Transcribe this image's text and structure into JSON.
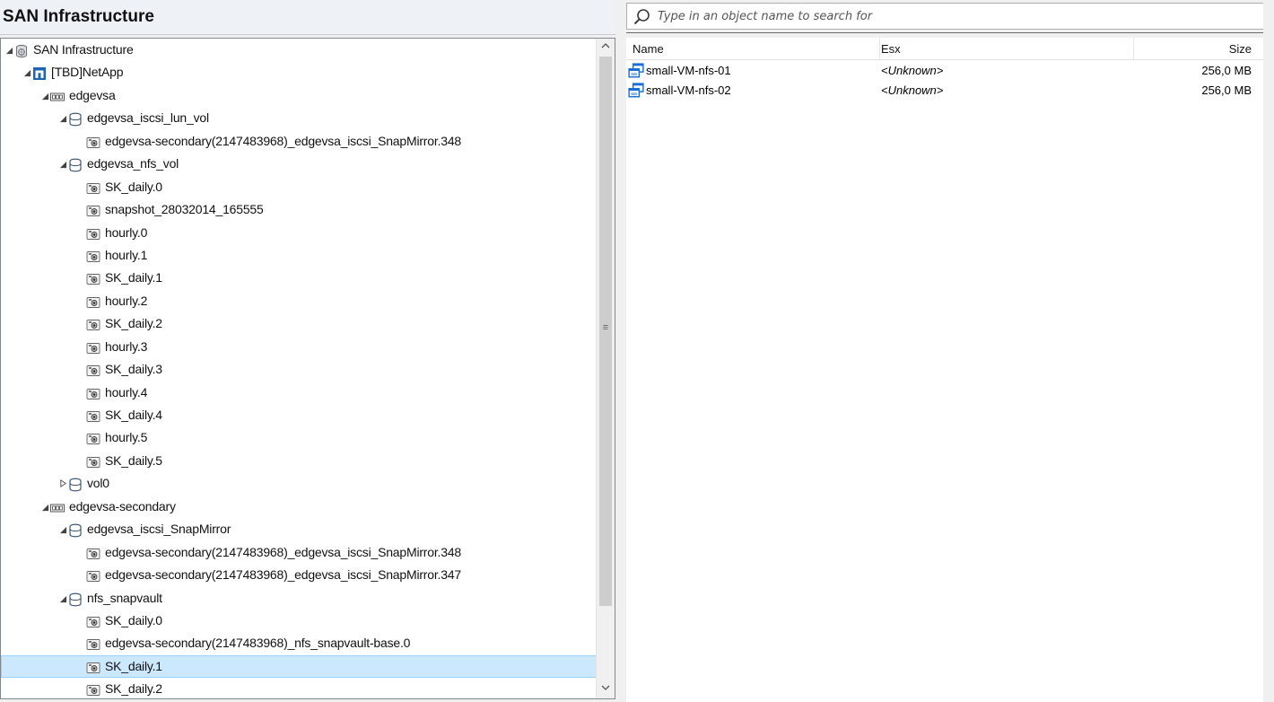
{
  "left_panel": {
    "title": "SAN Infrastructure",
    "tree": [
      {
        "label": "SAN Infrastructure",
        "level": 0,
        "expander": "expanded",
        "icon": "database-globe-icon"
      },
      {
        "label": "[TBD]NetApp",
        "level": 1,
        "expander": "expanded",
        "icon": "netapp-icon"
      },
      {
        "label": "edgevsa",
        "level": 2,
        "expander": "expanded",
        "icon": "storage-server-icon"
      },
      {
        "label": "edgevsa_iscsi_lun_vol",
        "level": 3,
        "expander": "expanded",
        "icon": "volume-icon"
      },
      {
        "label": "edgevsa-secondary(2147483968)_edgevsa_iscsi_SnapMirror.348",
        "level": 4,
        "expander": "none",
        "icon": "snapshot-icon"
      },
      {
        "label": "edgevsa_nfs_vol",
        "level": 3,
        "expander": "expanded",
        "icon": "volume-icon"
      },
      {
        "label": "SK_daily.0",
        "level": 4,
        "expander": "none",
        "icon": "snapshot-icon"
      },
      {
        "label": "snapshot_28032014_165555",
        "level": 4,
        "expander": "none",
        "icon": "snapshot-icon"
      },
      {
        "label": "hourly.0",
        "level": 4,
        "expander": "none",
        "icon": "snapshot-icon"
      },
      {
        "label": "hourly.1",
        "level": 4,
        "expander": "none",
        "icon": "snapshot-icon"
      },
      {
        "label": "SK_daily.1",
        "level": 4,
        "expander": "none",
        "icon": "snapshot-icon"
      },
      {
        "label": "hourly.2",
        "level": 4,
        "expander": "none",
        "icon": "snapshot-icon"
      },
      {
        "label": "SK_daily.2",
        "level": 4,
        "expander": "none",
        "icon": "snapshot-icon"
      },
      {
        "label": "hourly.3",
        "level": 4,
        "expander": "none",
        "icon": "snapshot-icon"
      },
      {
        "label": "SK_daily.3",
        "level": 4,
        "expander": "none",
        "icon": "snapshot-icon"
      },
      {
        "label": "hourly.4",
        "level": 4,
        "expander": "none",
        "icon": "snapshot-icon"
      },
      {
        "label": "SK_daily.4",
        "level": 4,
        "expander": "none",
        "icon": "snapshot-icon"
      },
      {
        "label": "hourly.5",
        "level": 4,
        "expander": "none",
        "icon": "snapshot-icon"
      },
      {
        "label": "SK_daily.5",
        "level": 4,
        "expander": "none",
        "icon": "snapshot-icon"
      },
      {
        "label": "vol0",
        "level": 3,
        "expander": "collapsed",
        "icon": "volume-icon"
      },
      {
        "label": "edgevsa-secondary",
        "level": 2,
        "expander": "expanded",
        "icon": "storage-server-icon"
      },
      {
        "label": "edgevsa_iscsi_SnapMirror",
        "level": 3,
        "expander": "expanded",
        "icon": "volume-icon"
      },
      {
        "label": "edgevsa-secondary(2147483968)_edgevsa_iscsi_SnapMirror.348",
        "level": 4,
        "expander": "none",
        "icon": "snapshot-icon"
      },
      {
        "label": "edgevsa-secondary(2147483968)_edgevsa_iscsi_SnapMirror.347",
        "level": 4,
        "expander": "none",
        "icon": "snapshot-icon"
      },
      {
        "label": "nfs_snapvault",
        "level": 3,
        "expander": "expanded",
        "icon": "volume-icon"
      },
      {
        "label": "SK_daily.0",
        "level": 4,
        "expander": "none",
        "icon": "snapshot-icon"
      },
      {
        "label": "edgevsa-secondary(2147483968)_nfs_snapvault-base.0",
        "level": 4,
        "expander": "none",
        "icon": "snapshot-icon"
      },
      {
        "label": "SK_daily.1",
        "level": 4,
        "expander": "none",
        "icon": "snapshot-icon",
        "selected": true
      },
      {
        "label": "SK_daily.2",
        "level": 4,
        "expander": "none",
        "icon": "snapshot-icon"
      }
    ],
    "scrollbar": {
      "up_icon": "chevron-up-icon",
      "down_icon": "chevron-down-icon",
      "grip": "≡"
    }
  },
  "right_panel": {
    "search": {
      "placeholder": "Type in an object name to search for",
      "value": ""
    },
    "grid": {
      "columns": [
        "Name",
        "Esx",
        "Size"
      ],
      "rows": [
        {
          "name": "small-VM-nfs-01",
          "esx": "<Unknown>",
          "size": "256,0 MB",
          "icon": "virtual-machine-icon"
        },
        {
          "name": "small-VM-nfs-02",
          "esx": "<Unknown>",
          "size": "256,0 MB",
          "icon": "virtual-machine-icon"
        }
      ]
    }
  },
  "colors": {
    "selection": "#cce8ff",
    "selection_border": "#99d1ff",
    "header_bg": "#eef1f6",
    "vm_icon": "#1c6fd6"
  }
}
